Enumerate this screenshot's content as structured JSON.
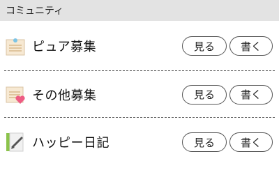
{
  "header": {
    "title": "コミュニティ"
  },
  "rows": [
    {
      "title": "ピュア募集",
      "icon": "memo-pin-icon",
      "view_label": "見る",
      "write_label": "書く"
    },
    {
      "title": "その他募集",
      "icon": "memo-heart-icon",
      "view_label": "見る",
      "write_label": "書く"
    },
    {
      "title": "ハッピー日記",
      "icon": "notebook-pen-icon",
      "view_label": "見る",
      "write_label": "書く"
    }
  ],
  "colors": {
    "header_bg": "#e3e3e3",
    "memo_bg": "#f7e9d3",
    "pin_blue": "#7cc4e6",
    "heart_pink": "#ee5c83",
    "notebook_green": "#8bc34a"
  }
}
